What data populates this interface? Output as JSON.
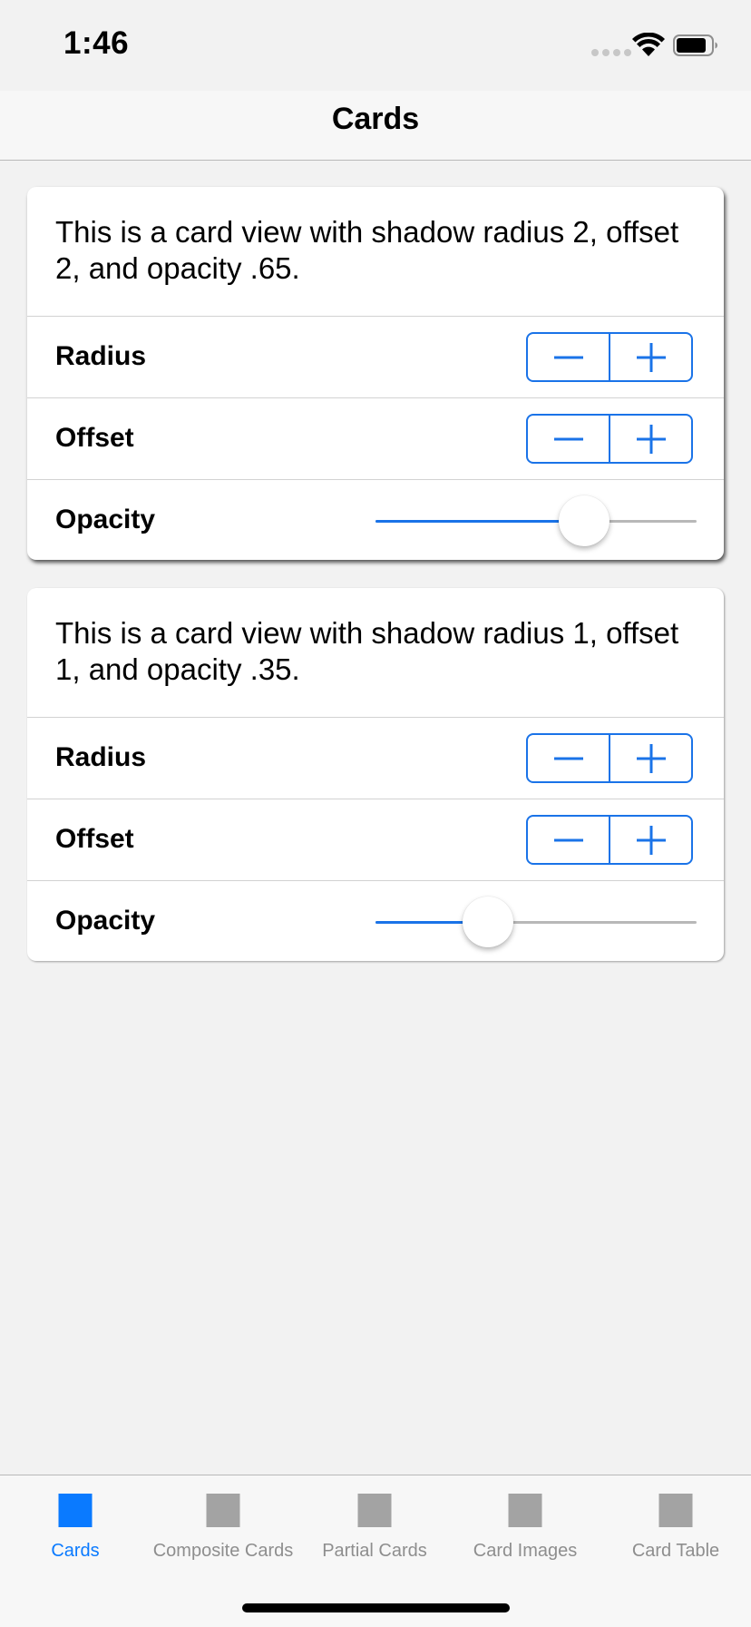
{
  "status_bar": {
    "time": "1:46"
  },
  "nav": {
    "title": "Cards"
  },
  "cards": [
    {
      "description": "This is a card view with shadow radius 2, offset 2, and opacity .65.",
      "radius_label": "Radius",
      "offset_label": "Offset",
      "opacity_label": "Opacity",
      "opacity_value": 0.65
    },
    {
      "description": "This is a card view with shadow radius 1, offset 1, and opacity .35.",
      "radius_label": "Radius",
      "offset_label": "Offset",
      "opacity_label": "Opacity",
      "opacity_value": 0.35
    }
  ],
  "tab_bar": {
    "items": [
      {
        "label": "Cards",
        "active": true
      },
      {
        "label": "Composite Cards",
        "active": false
      },
      {
        "label": "Partial Cards",
        "active": false
      },
      {
        "label": "Card Images",
        "active": false
      },
      {
        "label": "Card Table",
        "active": false
      }
    ]
  },
  "colors": {
    "accent": "#1a73e8",
    "tab_active": "#0a7aff",
    "tab_inactive": "#a3a3a3",
    "background": "#f2f2f2"
  },
  "icons": {
    "wifi": "wifi-icon",
    "battery": "battery-icon",
    "minus": "minus-icon",
    "plus": "plus-icon"
  }
}
